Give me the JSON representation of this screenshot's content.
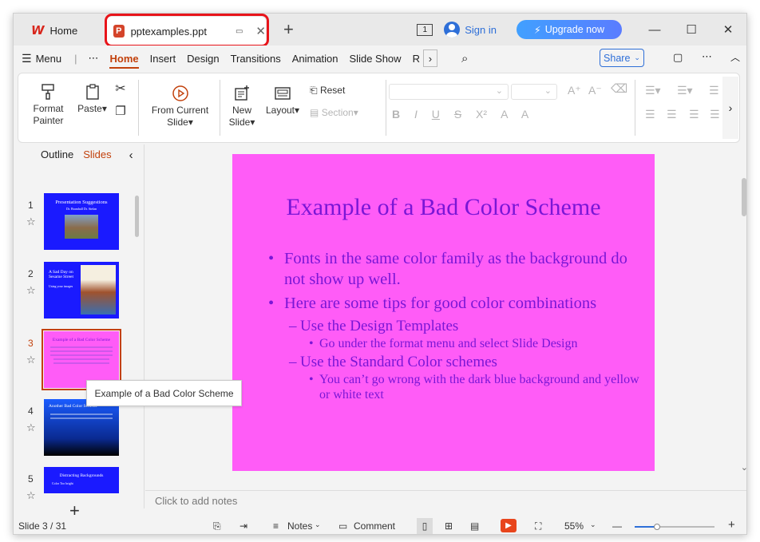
{
  "titlebar": {
    "home_tab": "Home",
    "doc_tab": "pptexamples.ppt",
    "slide_indicator": "1",
    "signin": "Sign in",
    "upgrade": "Upgrade now"
  },
  "menu": {
    "menu_label": "Menu",
    "items": [
      "Home",
      "Insert",
      "Design",
      "Transitions",
      "Animation",
      "Slide Show",
      "R"
    ],
    "share": "Share"
  },
  "ribbon": {
    "format_painter": "Format Painter",
    "format_painter_1": "Format",
    "format_painter_2": "Painter",
    "paste": "Paste",
    "from_current_slide_1": "From Current",
    "from_current_slide_2": "Slide",
    "new_slide_1": "New",
    "new_slide_2": "Slide",
    "layout": "Layout",
    "reset": "Reset",
    "section": "Section",
    "font_buttons": [
      "B",
      "I",
      "U",
      "S",
      "X²",
      "A",
      "A"
    ]
  },
  "left_panel": {
    "outline_tab": "Outline",
    "slides_tab": "Slides",
    "thumbnails": [
      {
        "num": "1",
        "title": "Presentation Suggestions",
        "sub": "Dr. Bramhall Dr. Stefan",
        "color": "#1a1aff"
      },
      {
        "num": "2",
        "title": "A Sad Day on Sesame Street",
        "sub": "Using your images",
        "color": "#1a1aff"
      },
      {
        "num": "3",
        "title": "Example of a Bad Color Scheme",
        "sub": "",
        "color": "#ff5cf7"
      },
      {
        "num": "4",
        "title": "Another Bad Color Scheme",
        "sub": "",
        "color": "#1a3aff"
      },
      {
        "num": "5",
        "title": "Distracting Backgrounds",
        "sub": "Color Too bright",
        "color": "#1a1aff"
      }
    ],
    "tooltip": "Example of a Bad Color Scheme"
  },
  "slide": {
    "title": "Example of a Bad Color Scheme",
    "bullet1": "Fonts in the same color family as the background do not show up well.",
    "bullet2": "Here are some tips for good color combinations",
    "sub1": "Use the Design Templates",
    "sub1_1": "Go under the format menu and select Slide Design",
    "sub2": "Use the Standard Color schemes",
    "sub2_1": "You can’t go wrong with the dark blue background and yellow or white text",
    "background_color": "#ff5cf7",
    "text_color": "#7a16d6"
  },
  "notes_placeholder": "Click to add notes",
  "status": {
    "slide_count": "Slide 3 / 31",
    "notes": "Notes",
    "comment": "Comment",
    "zoom": "55%"
  }
}
